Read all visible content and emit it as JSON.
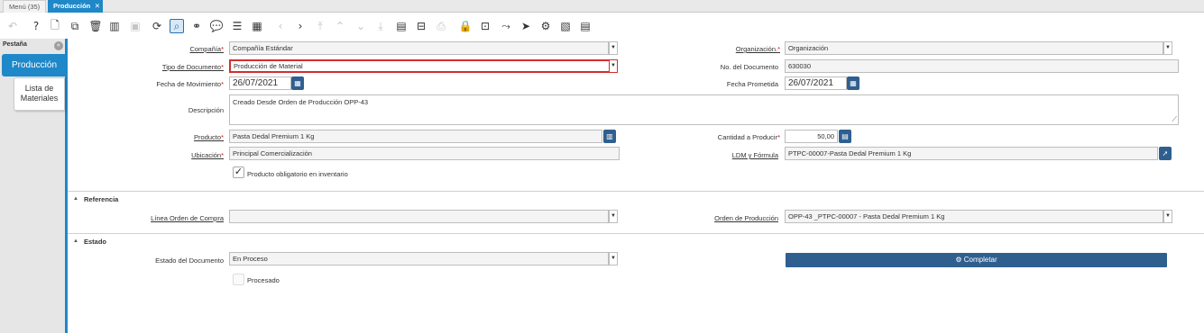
{
  "tabs": {
    "menu": "Menú (35)",
    "active": "Producción"
  },
  "toolbar_icons": [
    "undo-icon",
    "help-icon",
    "new-record-icon",
    "copy-record-icon",
    "delete-icon",
    "save-icon",
    "refresh-icon",
    "find-icon",
    "attachment-icon",
    "chat-icon",
    "toggle-grid-icon",
    "calendar-icon",
    "previous-icon",
    "next-icon",
    "first-icon",
    "up-icon",
    "down-icon",
    "last-icon",
    "report-icon",
    "archive-icon",
    "print-icon",
    "lock-icon",
    "zoom-across-icon",
    "workflow-icon",
    "send-icon",
    "process-icon",
    "customize-icon",
    "product-info-icon"
  ],
  "sidebar": {
    "title": "Pestaña",
    "tabs": [
      "Producción",
      "Lista de Materiales"
    ]
  },
  "form": {
    "compania_label": "Compañía",
    "compania_value": "Compañía Estándar",
    "organizacion_label": "Organización.",
    "organizacion_value": "Organización",
    "tipo_doc_label": "Tipo de Documento",
    "tipo_doc_value": "Producción de Material",
    "no_doc_label": "No. del Documento",
    "no_doc_value": "630030",
    "fecha_mov_label": "Fecha de Movimiento",
    "fecha_mov_value": "26/07/2021",
    "fecha_prom_label": "Fecha Prometida",
    "fecha_prom_value": "26/07/2021",
    "descripcion_label": "Descripción",
    "descripcion_value": "Creado Desde Orden de Producción OPP-43",
    "producto_label": "Producto",
    "producto_value": "Pasta Dedal Premium 1 Kg",
    "cantidad_label": "Cantidad a Producir",
    "cantidad_value": "50,00",
    "ubicacion_label": "Ubicación",
    "ubicacion_value": "Principal Comercialización",
    "ldm_label": "LDM y Fórmula",
    "ldm_value": "PTPC-00007-Pasta Dedal Premium 1 Kg",
    "obligatorio_label": "Producto obligatorio en inventario"
  },
  "referencia": {
    "title": "Referencia",
    "linea_label": "Línea Orden de Compra",
    "linea_value": "",
    "orden_label": "Orden de Producción",
    "orden_value": "OPP-43 _PTPC-00007 - Pasta Dedal Premium 1 Kg"
  },
  "estado": {
    "title": "Estado",
    "estado_doc_label": "Estado del Documento",
    "estado_doc_value": "En Proceso",
    "completar_label": "Completar",
    "procesado_label": "Procesado"
  }
}
